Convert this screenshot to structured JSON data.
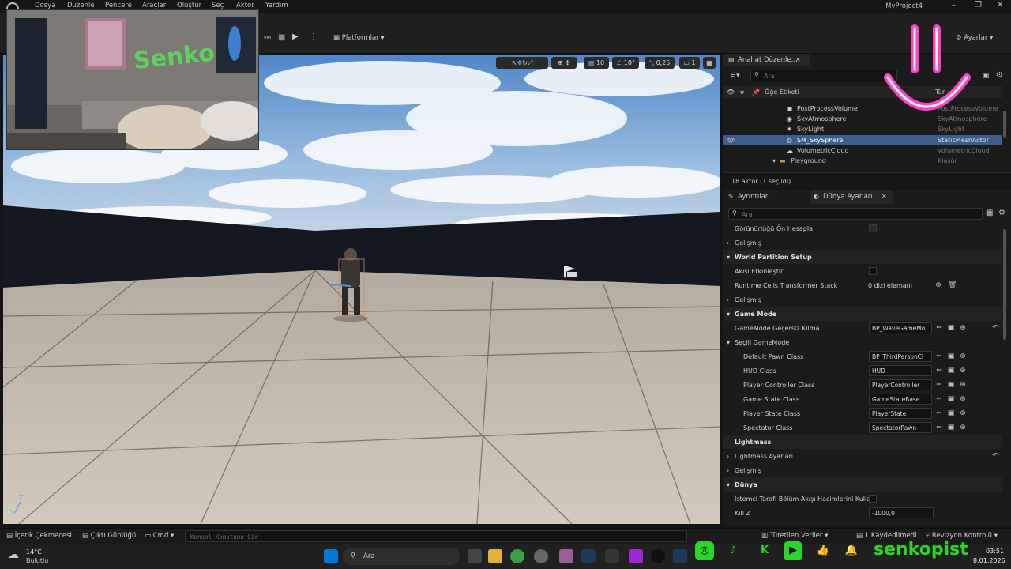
{
  "menubar": {
    "items": [
      "Dosya",
      "Düzenle",
      "Pencere",
      "Araçlar",
      "Oluştur",
      "Seç",
      "Aktör",
      "Yardım"
    ],
    "project_title": "MyProject4"
  },
  "toolbar": {
    "platforms_label": "Platformlar",
    "settings_label": "Ayarlar"
  },
  "viewport": {
    "grid_snap": "10",
    "rotation_snap": "10°",
    "scale_snap": "0,25",
    "camera_speed": "1"
  },
  "outliner": {
    "tab_label": "Anahat Düzenle...",
    "search_placeholder": "Ara",
    "col_label": "Öğe Etiketi",
    "col_type": "Tür",
    "rows": [
      {
        "label": "PostProcessVolume",
        "type": "PostProcessVolume"
      },
      {
        "label": "SkyAtmosphere",
        "type": "SkyAtmosphere"
      },
      {
        "label": "SkyLight",
        "type": "SkyLight"
      },
      {
        "label": "SM_SkySphere",
        "type": "StaticMeshActor"
      },
      {
        "label": "VolumetricCloud",
        "type": "VolumetricCloud"
      },
      {
        "label": "Playground",
        "type": "Klasör"
      }
    ],
    "actor_count": "18 aktör (1 seçildi)"
  },
  "details": {
    "tab_details": "Ayrıntılar",
    "tab_world": "Dünya Ayarları",
    "search_placeholder": "Ara",
    "rows": {
      "precompute_visibility": "Görünürlüğü Ön Hesapla",
      "advanced1": "Gelişmiş",
      "world_partition": "World Partition Setup",
      "enable_streaming": "Akışı Etkinleştir",
      "runtime_cells": "Runtime Cells Transformer Stack",
      "array_elements": "0 dizi elemanı",
      "advanced2": "Gelişmiş",
      "game_mode": "Game Mode",
      "gamemode_override": "GameMode Geçersiz Kılma",
      "gamemode_value": "BP_WaveGameMo",
      "selected_gamemode": "Seçili GameMode",
      "default_pawn": "Default Pawn Class",
      "default_pawn_value": "BP_ThirdPersonCl",
      "hud_class": "HUD Class",
      "hud_value": "HUD",
      "player_controller": "Player Controller Class",
      "player_controller_value": "PlayerController",
      "game_state": "Game State Class",
      "game_state_value": "GameStateBase",
      "player_state": "Player State Class",
      "player_state_value": "PlayerState",
      "spectator": "Spectator Class",
      "spectator_value": "SpectatorPawn",
      "lightmass": "Lightmass",
      "lightmass_settings": "Lightmass Ayarları",
      "advanced3": "Gelişmiş",
      "world": "Dünya",
      "client_streaming": "İstemci Tarafı Bölüm Akışı Hacimlerini Kullan",
      "kill_z": "Kill Z",
      "kill_z_value": "-1000,0"
    }
  },
  "statusbar": {
    "content_drawer": "İçerik Çekmecesi",
    "output_log": "Çıktı Günlüğü",
    "cmd": "Cmd",
    "console_placeholder": "Konsol Komutunu Gir",
    "derived_data": "Türetilen Veriler",
    "saved": "1 Kaydedilmedi",
    "revision": "Revizyon Kontrolü"
  },
  "taskbar": {
    "weather_temp": "14°C",
    "weather_desc": "Bulutlu",
    "search": "Ara",
    "time": "03:51",
    "date": "8.01.2026"
  },
  "webcam": {
    "wall_text": "Senko"
  },
  "overlay": {
    "channel_name": "senkopist"
  },
  "colors": {
    "accent": "#0078d4",
    "selection": "#264f78",
    "social_green": "#2bd629",
    "smiley_pink": "#ff3ecb"
  }
}
